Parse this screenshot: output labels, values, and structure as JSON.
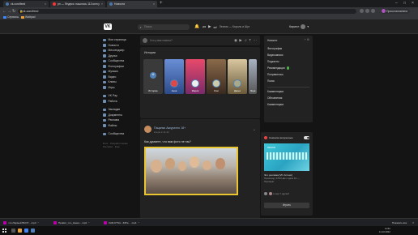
{
  "browser": {
    "tabs": [
      {
        "title": "vk.com/feed",
        "active": false
      },
      {
        "title": "рп — Яндекс: нашлось 113 млн ре",
        "active": false
      },
      {
        "title": "Новости",
        "active": true
      }
    ],
    "address": "vk.com/feed",
    "profile": "Приостановлено",
    "bookmarks": [
      "Сервисы",
      "Wattpad"
    ]
  },
  "vk": {
    "search_placeholder": "Поиск",
    "player_track": "Лесник — Король и Шут",
    "user_name": "Кирилл",
    "nav": [
      "Моя страница",
      "Новости",
      "Мессенджер",
      "Друзья",
      "Сообщества",
      "Фотографии",
      "Музыка",
      "Видео",
      "Клипы",
      "Игры",
      "VK Pay",
      "Работа",
      "Закладки",
      "Документы",
      "Реклама",
      "Файлы",
      "Сообщества"
    ],
    "nav_footer": [
      "Блог · Разработчикам",
      "Реклама · Ещё"
    ],
    "composer_placeholder": "Что у вас нового?",
    "stories_title": "Истории",
    "stories": [
      "Историю",
      "Анна",
      "Мария",
      "Олег",
      "Дарья",
      "Лида",
      "Ирина"
    ],
    "post": {
      "author": "Пацанки Аккуратно 18+",
      "date": "вчера в 11:42",
      "text": "Как думаете, что вам фото не так?"
    },
    "right_menu": {
      "title": "Новости",
      "items": [
        "Фотографии",
        "Видеозаписи",
        "Подкасты",
        "Рекомендации",
        "Понравилось",
        "Поиск"
      ],
      "items2": [
        "Комментарии",
        "Обновления",
        "Комментарии"
      ]
    },
    "ad": {
      "header": "Сначала интересные",
      "title": "Это реклама [VK Аптеки]",
      "text": "Промокод: 2700 Цвет сдачи 10 — Препарат",
      "friends": "и ещё 7 друзей",
      "button": "Играть",
      "image_label": "RESOR"
    }
  },
  "downloads": [
    {
      "name": "что-Первый ВСО?....mp4"
    },
    {
      "name": "Приват_что_Наша....mp4"
    },
    {
      "name": "KAR-KTSA - ЗЗУя... .mp4"
    }
  ],
  "downloads_showall": "Показать все",
  "taskbar": {
    "time": "11:52",
    "date": "11.10.2022"
  },
  "colors": {
    "vk_blue": "#5181b8",
    "accent_yellow": "#e9c531"
  }
}
